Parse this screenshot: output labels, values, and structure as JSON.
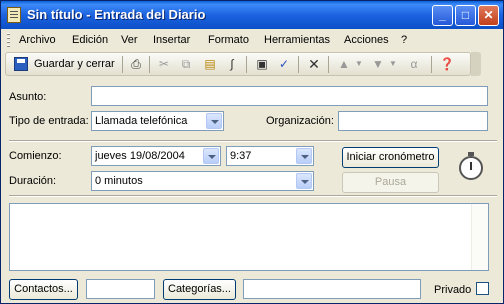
{
  "window": {
    "title": "Sin título - Entrada del Diario",
    "minimize": "_",
    "maximize": "□",
    "close": "✕"
  },
  "menu": [
    "Archivo",
    "Edición",
    "Ver",
    "Insertar",
    "Formato",
    "Herramientas",
    "Acciones",
    "?"
  ],
  "toolbar": {
    "save_close_label": "Guardar y cerrar"
  },
  "form": {
    "subject_label": "Asunto:",
    "subject_value": "",
    "entry_type_label": "Tipo de entrada:",
    "entry_type_value": "Llamada telefónica",
    "organization_label": "Organización:",
    "organization_value": "",
    "start_label": "Comienzo:",
    "start_date": "jueves 19/08/2004",
    "start_time": "9:37",
    "duration_label": "Duración:",
    "duration_value": "0 minutos",
    "start_timer_button": "Iniciar cronómetro",
    "pause_button": "Pausa",
    "notes_value": ""
  },
  "footer": {
    "contacts_button": "Contactos...",
    "contacts_value": "",
    "categories_button": "Categorías...",
    "categories_value": "",
    "private_label": "Privado",
    "private_checked": false
  }
}
